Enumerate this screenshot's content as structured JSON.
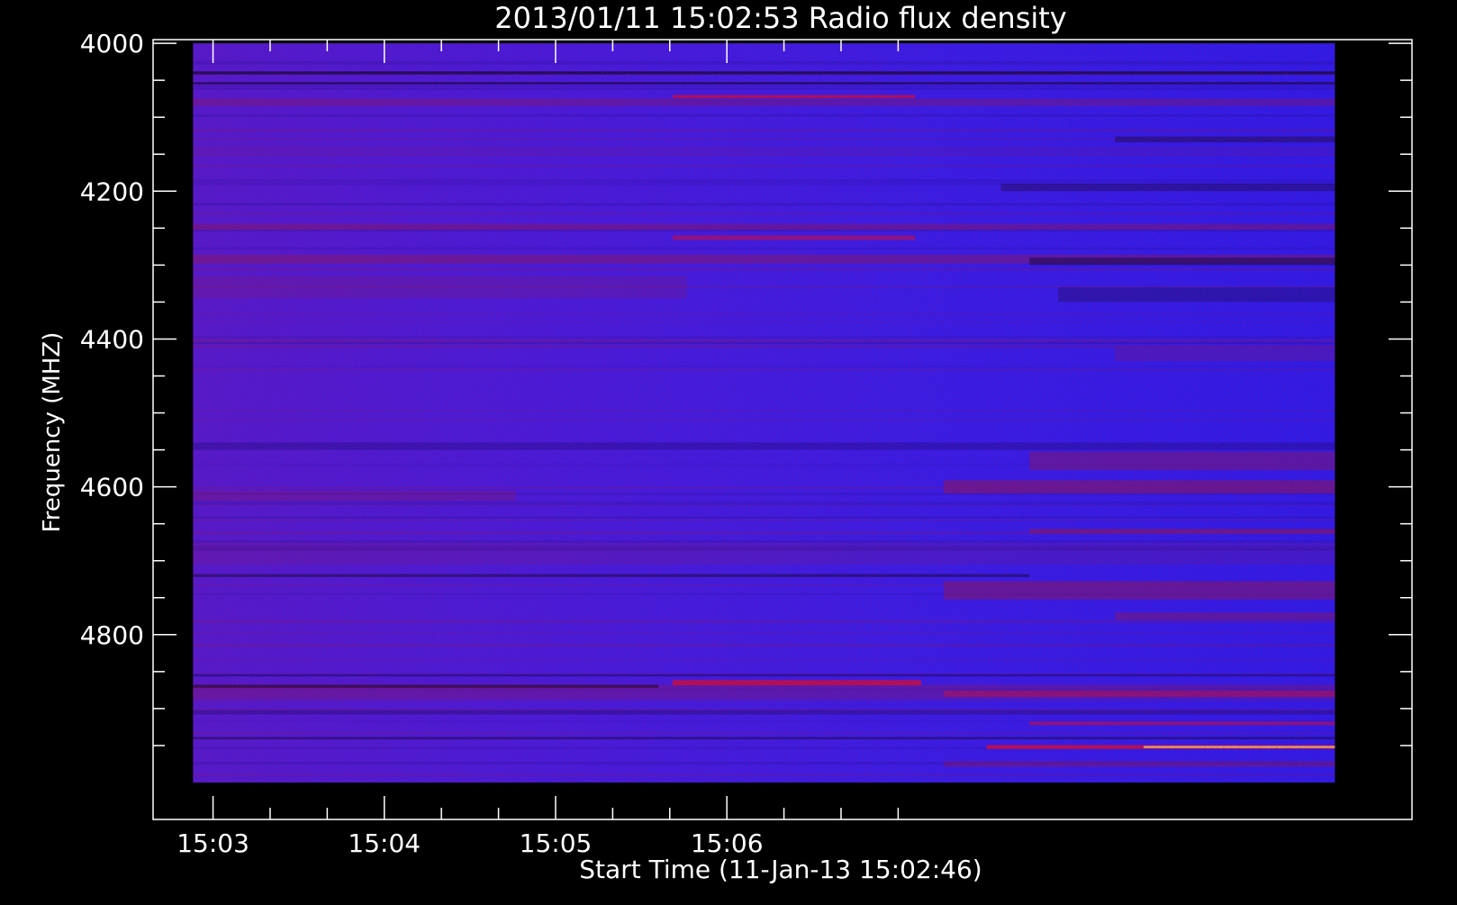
{
  "colors": {
    "background": "#000000",
    "axes": "#ffffff",
    "text": "#ffffff",
    "base_blue": "#2a1cf0",
    "deep_blue": "#12108a",
    "dark_band": "#0a0d45",
    "red_band": "#8a1a52",
    "bright_red": "#d8102a",
    "hot_yellow": "#ffe46a"
  },
  "chart_data": {
    "type": "heatmap",
    "title": "2013/01/11 15:02:53 Radio flux density",
    "xlabel": "Start Time (11-Jan-13 15:02:46)",
    "ylabel": "Frequency (MHZ)",
    "x_unit": "seconds after 15:02:46",
    "xlim": [
      -7,
      434
    ],
    "ylim": [
      3995,
      5050
    ],
    "data_extent": {
      "x": [
        7,
        407
      ],
      "y": [
        4000,
        5000
      ]
    },
    "x_major_ticks": [
      {
        "value": 14,
        "label": "15:03"
      },
      {
        "value": 74,
        "label": "15:04"
      },
      {
        "value": 134,
        "label": "15:05"
      },
      {
        "value": 194,
        "label": "15:06"
      }
    ],
    "x_minor_ticks": [
      34,
      54,
      94,
      114,
      154,
      174,
      214,
      234,
      254
    ],
    "y_major_ticks": [
      {
        "value": 4000,
        "label": "4000"
      },
      {
        "value": 4200,
        "label": "4200"
      },
      {
        "value": 4400,
        "label": "4400"
      },
      {
        "value": 4600,
        "label": "4600"
      },
      {
        "value": 4800,
        "label": "4800"
      }
    ],
    "y_minor_ticks": [
      4050,
      4100,
      4150,
      4250,
      4300,
      4350,
      4450,
      4500,
      4550,
      4650,
      4700,
      4750,
      4850,
      4900,
      4950
    ],
    "colormap": "blue-red-yellow",
    "horizontal_bands": [
      {
        "f": 4040,
        "x0": 7,
        "x1": 407,
        "thickness_mhz": 4,
        "color": "dark_band",
        "opacity": 0.9
      },
      {
        "f": 4054,
        "x0": 7,
        "x1": 407,
        "thickness_mhz": 3,
        "color": "dark_band",
        "opacity": 0.8
      },
      {
        "f": 4072,
        "x0": 175,
        "x1": 260,
        "thickness_mhz": 4,
        "color": "bright_red",
        "opacity": 0.75
      },
      {
        "f": 4080,
        "x0": 7,
        "x1": 407,
        "thickness_mhz": 10,
        "color": "red_band",
        "opacity": 0.35
      },
      {
        "f": 4130,
        "x0": 330,
        "x1": 407,
        "thickness_mhz": 8,
        "color": "dark_band",
        "opacity": 0.5
      },
      {
        "f": 4195,
        "x0": 290,
        "x1": 407,
        "thickness_mhz": 10,
        "color": "dark_band",
        "opacity": 0.45
      },
      {
        "f": 4248,
        "x0": 7,
        "x1": 407,
        "thickness_mhz": 8,
        "color": "red_band",
        "opacity": 0.4
      },
      {
        "f": 4263,
        "x0": 175,
        "x1": 260,
        "thickness_mhz": 6,
        "color": "bright_red",
        "opacity": 0.55
      },
      {
        "f": 4292,
        "x0": 7,
        "x1": 407,
        "thickness_mhz": 12,
        "color": "red_band",
        "opacity": 0.45
      },
      {
        "f": 4295,
        "x0": 300,
        "x1": 407,
        "thickness_mhz": 10,
        "color": "dark_band",
        "opacity": 0.6
      },
      {
        "f": 4330,
        "x0": 7,
        "x1": 180,
        "thickness_mhz": 30,
        "color": "red_band",
        "opacity": 0.22
      },
      {
        "f": 4340,
        "x0": 310,
        "x1": 407,
        "thickness_mhz": 20,
        "color": "dark_band",
        "opacity": 0.35
      },
      {
        "f": 4420,
        "x0": 330,
        "x1": 407,
        "thickness_mhz": 20,
        "color": "red_band",
        "opacity": 0.25
      },
      {
        "f": 4545,
        "x0": 7,
        "x1": 407,
        "thickness_mhz": 10,
        "color": "deep_blue",
        "opacity": 0.45
      },
      {
        "f": 4565,
        "x0": 300,
        "x1": 407,
        "thickness_mhz": 25,
        "color": "red_band",
        "opacity": 0.45
      },
      {
        "f": 4600,
        "x0": 270,
        "x1": 407,
        "thickness_mhz": 18,
        "color": "red_band",
        "opacity": 0.55
      },
      {
        "f": 4612,
        "x0": 7,
        "x1": 120,
        "thickness_mhz": 14,
        "color": "red_band",
        "opacity": 0.3
      },
      {
        "f": 4660,
        "x0": 300,
        "x1": 407,
        "thickness_mhz": 6,
        "color": "red_band",
        "opacity": 0.6
      },
      {
        "f": 4690,
        "x0": 7,
        "x1": 407,
        "thickness_mhz": 30,
        "color": "red_band",
        "opacity": 0.18
      },
      {
        "f": 4720,
        "x0": 7,
        "x1": 300,
        "thickness_mhz": 4,
        "color": "dark_band",
        "opacity": 0.6
      },
      {
        "f": 4740,
        "x0": 270,
        "x1": 407,
        "thickness_mhz": 25,
        "color": "red_band",
        "opacity": 0.5
      },
      {
        "f": 4775,
        "x0": 330,
        "x1": 407,
        "thickness_mhz": 10,
        "color": "red_band",
        "opacity": 0.45
      },
      {
        "f": 4855,
        "x0": 7,
        "x1": 407,
        "thickness_mhz": 3,
        "color": "deep_blue",
        "opacity": 0.8
      },
      {
        "f": 4865,
        "x0": 175,
        "x1": 262,
        "thickness_mhz": 7,
        "color": "bright_red",
        "opacity": 0.8
      },
      {
        "f": 4870,
        "x0": 7,
        "x1": 170,
        "thickness_mhz": 4,
        "color": "dark_band",
        "opacity": 0.95
      },
      {
        "f": 4878,
        "x0": 7,
        "x1": 407,
        "thickness_mhz": 18,
        "color": "red_band",
        "opacity": 0.35
      },
      {
        "f": 4880,
        "x0": 270,
        "x1": 407,
        "thickness_mhz": 8,
        "color": "bright_red",
        "opacity": 0.45
      },
      {
        "f": 4905,
        "x0": 7,
        "x1": 407,
        "thickness_mhz": 6,
        "color": "deep_blue",
        "opacity": 0.5
      },
      {
        "f": 4920,
        "x0": 300,
        "x1": 407,
        "thickness_mhz": 5,
        "color": "bright_red",
        "opacity": 0.55
      },
      {
        "f": 4940,
        "x0": 7,
        "x1": 407,
        "thickness_mhz": 3,
        "color": "dark_band",
        "opacity": 0.6
      },
      {
        "f": 4952,
        "x0": 285,
        "x1": 407,
        "thickness_mhz": 5,
        "color": "bright_red",
        "opacity": 0.85
      },
      {
        "f": 4952,
        "x0": 340,
        "x1": 407,
        "thickness_mhz": 3,
        "color": "hot_yellow",
        "opacity": 0.8
      },
      {
        "f": 4975,
        "x0": 270,
        "x1": 407,
        "thickness_mhz": 8,
        "color": "red_band",
        "opacity": 0.4
      }
    ]
  }
}
